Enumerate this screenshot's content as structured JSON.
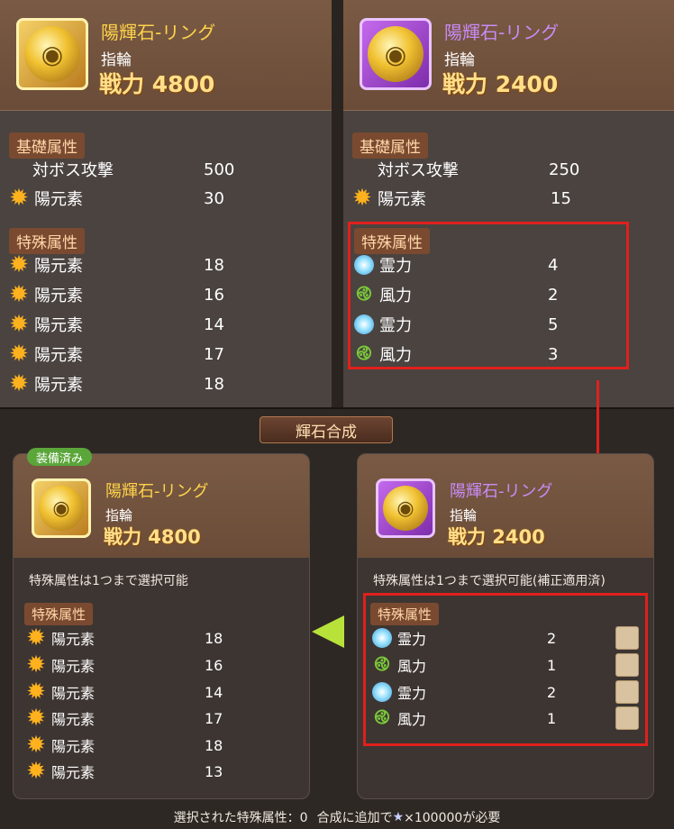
{
  "top_left": {
    "name": "陽輝石-リング",
    "type": "指輪",
    "power": "戦力 4800",
    "base_label": "基礎属性",
    "base_stats": [
      {
        "icon": "none",
        "name": "対ボス攻撃",
        "value": "500"
      },
      {
        "icon": "sun",
        "name": "陽元素",
        "value": "30"
      }
    ],
    "special_label": "特殊属性",
    "special_stats": [
      {
        "icon": "sun",
        "name": "陽元素",
        "value": "18"
      },
      {
        "icon": "sun",
        "name": "陽元素",
        "value": "16"
      },
      {
        "icon": "sun",
        "name": "陽元素",
        "value": "14"
      },
      {
        "icon": "sun",
        "name": "陽元素",
        "value": "17"
      },
      {
        "icon": "sun",
        "name": "陽元素",
        "value": "18"
      }
    ]
  },
  "top_right": {
    "name": "陽輝石-リング",
    "type": "指輪",
    "power": "戦力 2400",
    "base_label": "基礎属性",
    "base_stats": [
      {
        "icon": "none",
        "name": "対ボス攻撃",
        "value": "250"
      },
      {
        "icon": "sun",
        "name": "陽元素",
        "value": "15"
      }
    ],
    "special_label": "特殊属性",
    "special_stats": [
      {
        "icon": "spirit",
        "name": "霊力",
        "value": "4"
      },
      {
        "icon": "wind",
        "name": "風力",
        "value": "2"
      },
      {
        "icon": "spirit",
        "name": "霊力",
        "value": "5"
      },
      {
        "icon": "wind",
        "name": "風力",
        "value": "3"
      }
    ]
  },
  "synthesis_title": "輝石合成",
  "bottom_left": {
    "badge": "装備済み",
    "name": "陽輝石-リング",
    "type": "指輪",
    "power": "戦力 4800",
    "note": "特殊属性は1つまで選択可能",
    "special_label": "特殊属性",
    "special_stats": [
      {
        "icon": "sun",
        "name": "陽元素",
        "value": "18"
      },
      {
        "icon": "sun",
        "name": "陽元素",
        "value": "16"
      },
      {
        "icon": "sun",
        "name": "陽元素",
        "value": "14"
      },
      {
        "icon": "sun",
        "name": "陽元素",
        "value": "17"
      },
      {
        "icon": "sun",
        "name": "陽元素",
        "value": "18"
      },
      {
        "icon": "sun",
        "name": "陽元素",
        "value": "13"
      }
    ]
  },
  "bottom_right": {
    "name": "陽輝石-リング",
    "type": "指輪",
    "power": "戦力 2400",
    "note": "特殊属性は1つまで選択可能(補正適用済)",
    "special_label": "特殊属性",
    "special_stats": [
      {
        "icon": "spirit",
        "name": "霊力",
        "value": "2"
      },
      {
        "icon": "wind",
        "name": "風力",
        "value": "1"
      },
      {
        "icon": "spirit",
        "name": "霊力",
        "value": "2"
      },
      {
        "icon": "wind",
        "name": "風力",
        "value": "1"
      }
    ]
  },
  "footer": {
    "selected_label": "選択された特殊属性：0",
    "cost_label": "合成に追加で",
    "cost_value": "×100000が必要"
  },
  "colors": {
    "gold": "#ffd34a",
    "purple": "#c88bf5",
    "highlight": "#e0201c"
  }
}
